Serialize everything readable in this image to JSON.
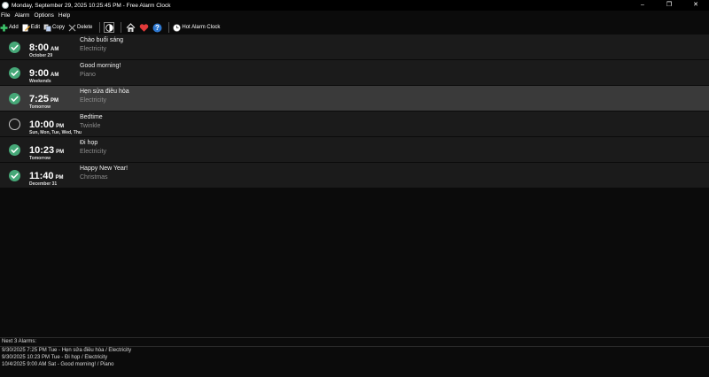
{
  "window": {
    "title": "Monday, September 29, 2025 10:25:45 PM - Free Alarm Clock",
    "buttons": [
      "–",
      "❐",
      "✕"
    ]
  },
  "menu": [
    "File",
    "Alarm",
    "Options",
    "Help"
  ],
  "toolbar": {
    "add": "Add",
    "edit": "Edit",
    "copy": "Copy",
    "delete": "Delete",
    "hot_alarm": "Hot Alarm Clock"
  },
  "alarms": [
    {
      "enabled": true,
      "time": "8:00",
      "ampm": "AM",
      "when": "October 29",
      "label": "Chào buổi sáng",
      "sound": "Electricity",
      "selected": false
    },
    {
      "enabled": true,
      "time": "9:00",
      "ampm": "AM",
      "when": "Weekends",
      "label": "Good morning!",
      "sound": "Piano",
      "selected": false
    },
    {
      "enabled": true,
      "time": "7:25",
      "ampm": "PM",
      "when": "Tomorrow",
      "label": "Hẹn sửa điều hòa",
      "sound": "Electricity",
      "selected": true
    },
    {
      "enabled": false,
      "time": "10:00",
      "ampm": "PM",
      "when": "Sun, Mon, Tue, Wed, Thu",
      "label": "Bedtime",
      "sound": "Twinkle",
      "selected": false
    },
    {
      "enabled": true,
      "time": "10:23",
      "ampm": "PM",
      "when": "Tomorrow",
      "label": "Đi họp",
      "sound": "Electricity",
      "selected": false
    },
    {
      "enabled": true,
      "time": "11:40",
      "ampm": "PM",
      "when": "December 31",
      "label": "Happy New Year!",
      "sound": "Christmas",
      "selected": false
    }
  ],
  "footer": {
    "title": "Next 3 Alarms:",
    "lines": [
      "9/30/2025 7:25 PM Tue - Hẹn sửa điều hòa / Electricity",
      "9/30/2025 10:23 PM Tue - Đi họp / Electricity",
      "10/4/2025 9:00 AM Sat - Good morning! / Piano"
    ]
  },
  "colors": {
    "enabled_check": "#46a878",
    "row_bg": "#1b1b1b",
    "row_selected": "#3a3a3a"
  }
}
